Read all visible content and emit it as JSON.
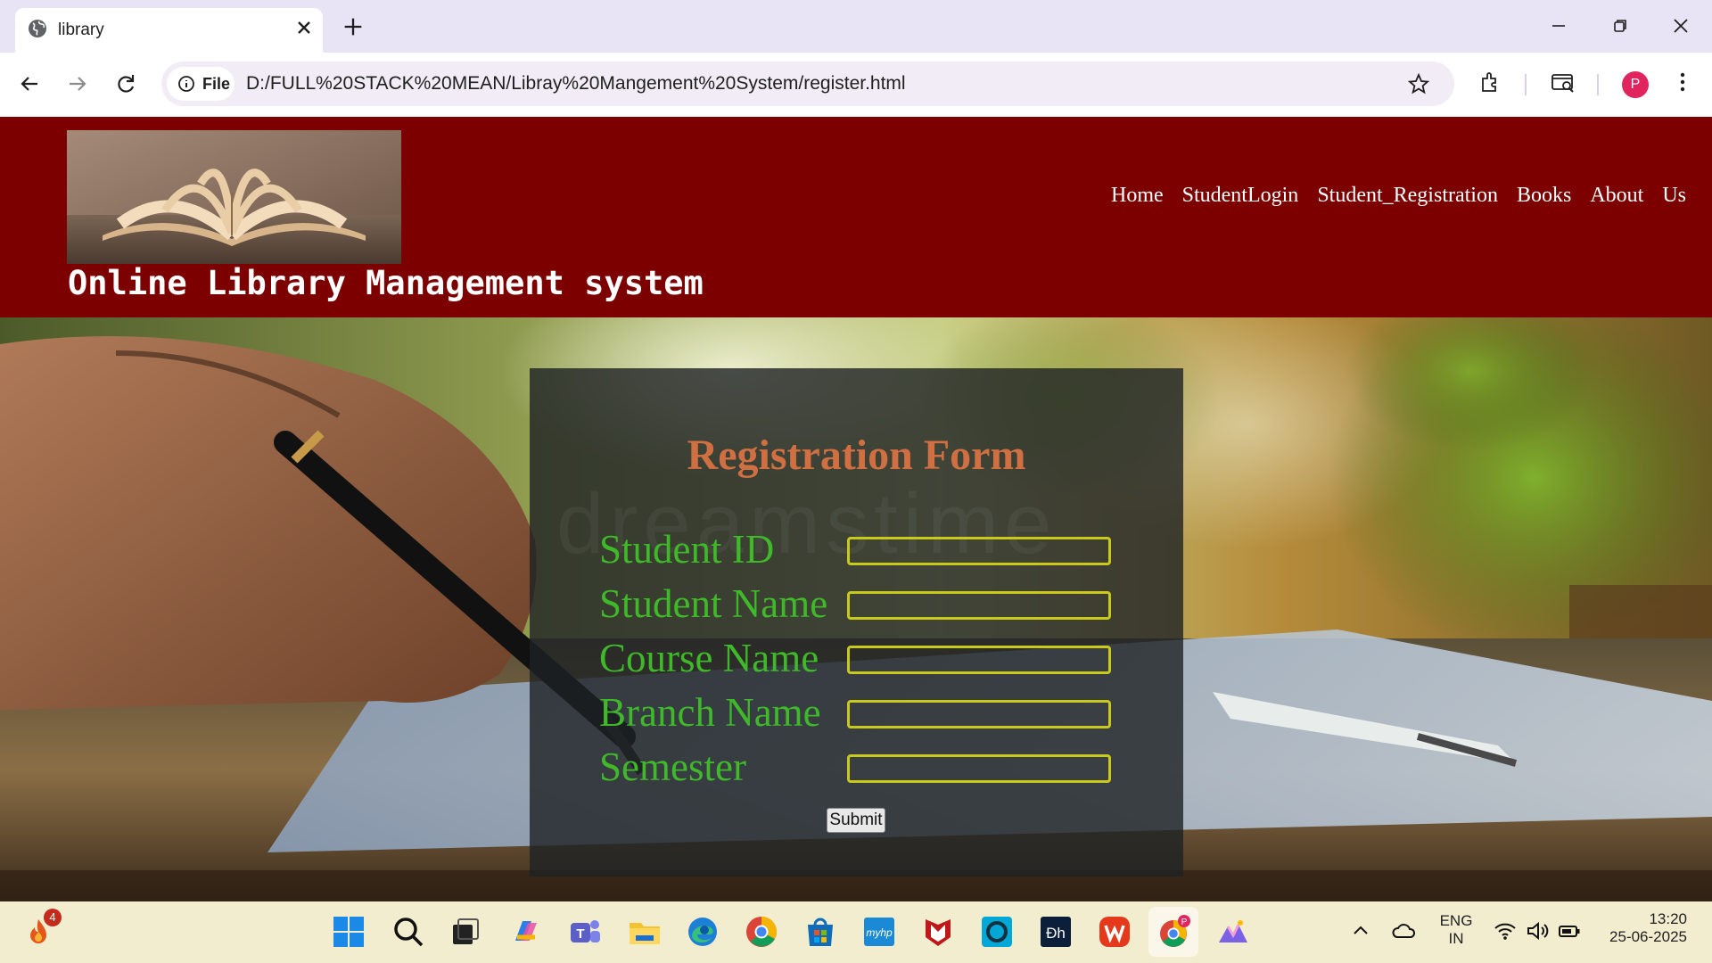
{
  "browser": {
    "tab_title": "library",
    "site_chip_label": "File",
    "url": "D:/FULL%20STACK%20MEAN/Libray%20Mangement%20System/register.html",
    "profile_initial": "P"
  },
  "site": {
    "title": "Online Library Management system",
    "menu": [
      "Home",
      "StudentLogin",
      "Student_Registration",
      "Books",
      "About",
      "Us"
    ]
  },
  "form": {
    "title": "Registration Form",
    "watermark": "dreamstime",
    "fields": [
      {
        "label": "Student ID",
        "value": ""
      },
      {
        "label": "Student Name",
        "value": ""
      },
      {
        "label": "Course Name",
        "value": ""
      },
      {
        "label": "Branch Name",
        "value": ""
      },
      {
        "label": "Semester",
        "value": ""
      }
    ],
    "submit_label": "Submit"
  },
  "taskbar": {
    "notification_count": "4",
    "teams_badge": "P",
    "language_line1": "ENG",
    "language_line2": "IN",
    "time": "13:20",
    "date": "25-06-2025"
  },
  "colors": {
    "header_bg": "#7d0000",
    "form_title": "#d06f42",
    "label_green": "#3fb82a",
    "input_border": "#c9c91c"
  },
  "icons": [
    "globe-icon",
    "close-icon",
    "plus-icon",
    "minimize-icon",
    "restore-icon",
    "back-icon",
    "forward-icon",
    "reload-icon",
    "info-icon",
    "star-icon",
    "extensions-icon",
    "tab-search-icon",
    "more-icon"
  ]
}
